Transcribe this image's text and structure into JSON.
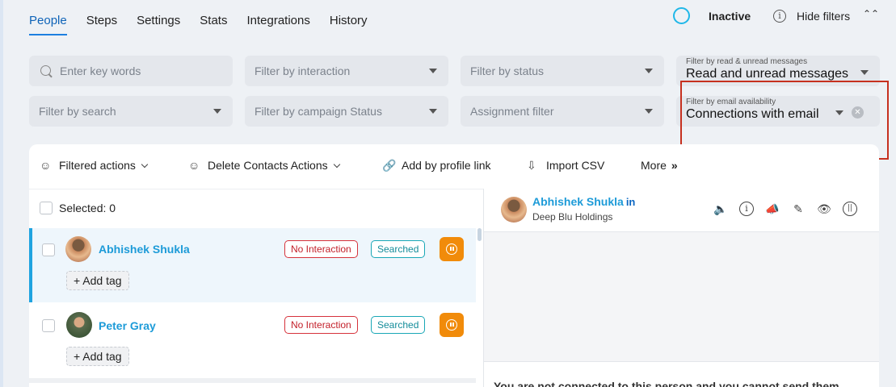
{
  "tabs": [
    "People",
    "Steps",
    "Settings",
    "Stats",
    "Integrations",
    "History"
  ],
  "status": {
    "label": "Inactive",
    "ring_color": "#1fb7e8"
  },
  "header": {
    "hide_filters": "Hide filters"
  },
  "filters": {
    "keywords_placeholder": "Enter key words",
    "interaction": "Filter by interaction",
    "status": "Filter by status",
    "read_label": "Filter by read & unread messages",
    "read_value": "Read and unread messages",
    "search": "Filter by search",
    "campaign_status": "Filter by campaign Status",
    "assignment": "Assignment filter",
    "email_label": "Filter by email availability",
    "email_value": "Connections with email"
  },
  "actions": {
    "filtered": "Filtered actions",
    "delete": "Delete Contacts Actions",
    "add_profile": "Add by profile link",
    "import": "Import CSV",
    "more": "More"
  },
  "list": {
    "selected": "Selected: 0",
    "people": [
      {
        "name": "Abhishek Shukla",
        "badges": [
          "No Interaction",
          "Searched"
        ],
        "tag": "Add tag"
      },
      {
        "name": "Peter Gray",
        "badges": [
          "No Interaction",
          "Searched"
        ],
        "tag": "Add tag"
      }
    ]
  },
  "detail": {
    "name": "Abhishek Shukla",
    "linkedin": "in",
    "company": "Deep Blu Holdings",
    "message": "You are not connected to this person and you cannot send them"
  },
  "colors": {
    "accent": "#1d7fe0",
    "name_blue": "#1d9bd8",
    "pause_orange": "#f18b0a",
    "highlight_red": "#c6301f"
  }
}
